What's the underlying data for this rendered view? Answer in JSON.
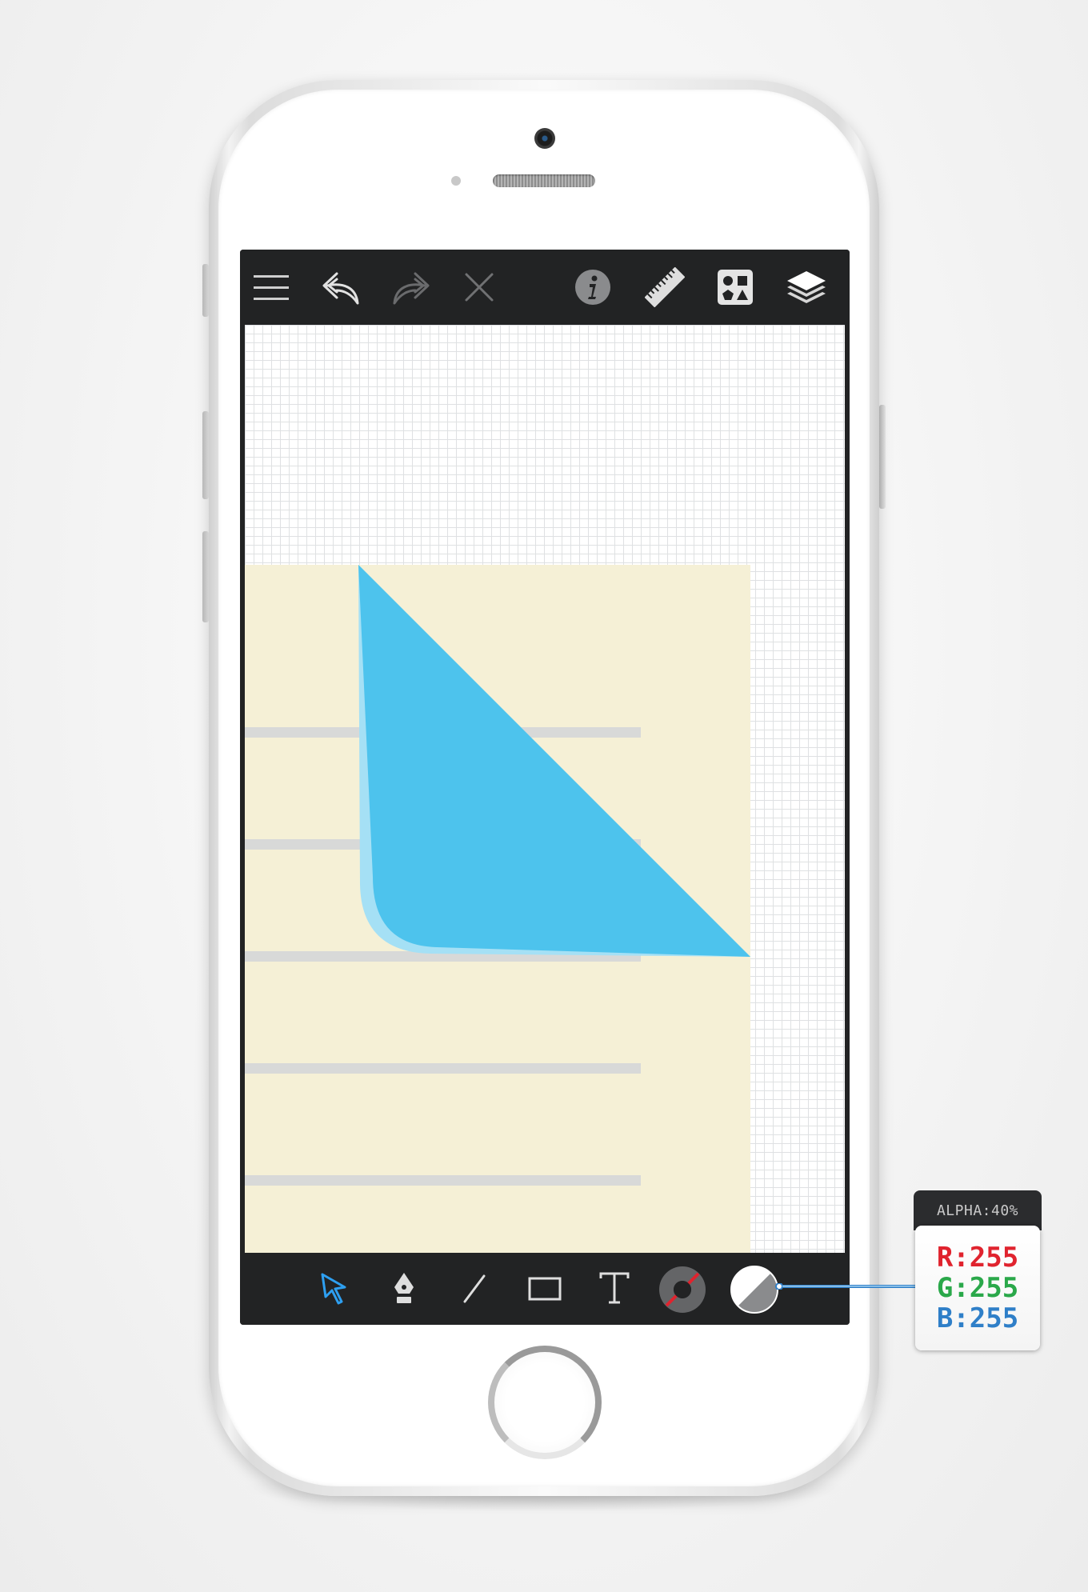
{
  "device": {
    "accent_blue": "#4dc3ed",
    "paper_color": "#f5f0d6"
  },
  "top_toolbar": {
    "items": [
      {
        "name": "menu",
        "icon": "hamburger-menu-icon",
        "enabled": true
      },
      {
        "name": "undo",
        "icon": "undo-icon",
        "enabled": true
      },
      {
        "name": "redo",
        "icon": "redo-icon",
        "enabled": false
      },
      {
        "name": "delete",
        "icon": "close-icon",
        "enabled": false
      },
      {
        "name": "info",
        "icon": "info-icon",
        "enabled": true
      },
      {
        "name": "ruler",
        "icon": "ruler-icon",
        "enabled": true
      },
      {
        "name": "shapes",
        "icon": "shapes-library-icon",
        "enabled": true
      },
      {
        "name": "layers",
        "icon": "layers-icon",
        "enabled": true
      }
    ]
  },
  "bottom_toolbar": {
    "items": [
      {
        "name": "select",
        "icon": "pointer-arrow-icon",
        "active": true
      },
      {
        "name": "pen",
        "icon": "pen-nib-icon",
        "active": false
      },
      {
        "name": "line",
        "icon": "line-tool-icon",
        "active": false
      },
      {
        "name": "rectangle",
        "icon": "rectangle-tool-icon",
        "active": false
      },
      {
        "name": "text",
        "icon": "text-tool-icon",
        "active": false
      },
      {
        "name": "stroke",
        "icon": "stroke-color-icon",
        "active": false
      },
      {
        "name": "fill",
        "icon": "fill-color-icon",
        "active": false
      }
    ]
  },
  "color_readout": {
    "alpha": "ALPHA:40%",
    "r_label": "R:",
    "r_value": "255",
    "g_label": "G:",
    "g_value": "255",
    "b_label": "B:",
    "b_value": "255",
    "r_color": "#e0232e",
    "g_color": "#2aa84a",
    "b_color": "#2f7fc8"
  }
}
